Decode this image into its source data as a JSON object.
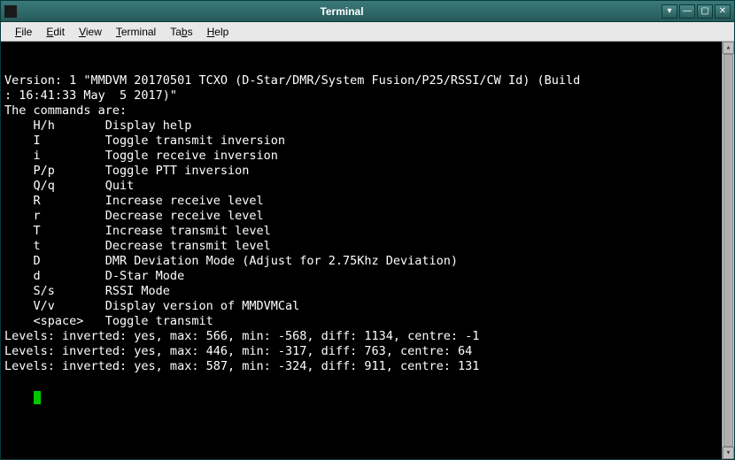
{
  "window": {
    "title": "Terminal"
  },
  "menubar": {
    "items": [
      {
        "label": "File",
        "accel": 0
      },
      {
        "label": "Edit",
        "accel": 0
      },
      {
        "label": "View",
        "accel": 0
      },
      {
        "label": "Terminal",
        "accel": 0
      },
      {
        "label": "Tabs",
        "accel": 2
      },
      {
        "label": "Help",
        "accel": 0
      }
    ]
  },
  "terminal": {
    "version_line_1": "Version: 1 \"MMDVM 20170501 TCXO (D-Star/DMR/System Fusion/P25/RSSI/CW Id) (Build",
    "version_line_2": ": 16:41:33 May  5 2017)\"",
    "commands_header": "The commands are:",
    "commands": [
      {
        "key": "H/h",
        "desc": "Display help"
      },
      {
        "key": "I",
        "desc": "Toggle transmit inversion"
      },
      {
        "key": "i",
        "desc": "Toggle receive inversion"
      },
      {
        "key": "P/p",
        "desc": "Toggle PTT inversion"
      },
      {
        "key": "Q/q",
        "desc": "Quit"
      },
      {
        "key": "R",
        "desc": "Increase receive level"
      },
      {
        "key": "r",
        "desc": "Decrease receive level"
      },
      {
        "key": "T",
        "desc": "Increase transmit level"
      },
      {
        "key": "t",
        "desc": "Decrease transmit level"
      },
      {
        "key": "D",
        "desc": "DMR Deviation Mode (Adjust for 2.75Khz Deviation)"
      },
      {
        "key": "d",
        "desc": "D-Star Mode"
      },
      {
        "key": "S/s",
        "desc": "RSSI Mode"
      },
      {
        "key": "V/v",
        "desc": "Display version of MMDVMCal"
      },
      {
        "key": "<space>",
        "desc": "Toggle transmit"
      }
    ],
    "levels": [
      {
        "inverted": "yes",
        "max": 566,
        "min": -568,
        "diff": 1134,
        "centre": -1
      },
      {
        "inverted": "yes",
        "max": 446,
        "min": -317,
        "diff": 763,
        "centre": 64
      },
      {
        "inverted": "yes",
        "max": 587,
        "min": -324,
        "diff": 911,
        "centre": 131
      }
    ]
  }
}
